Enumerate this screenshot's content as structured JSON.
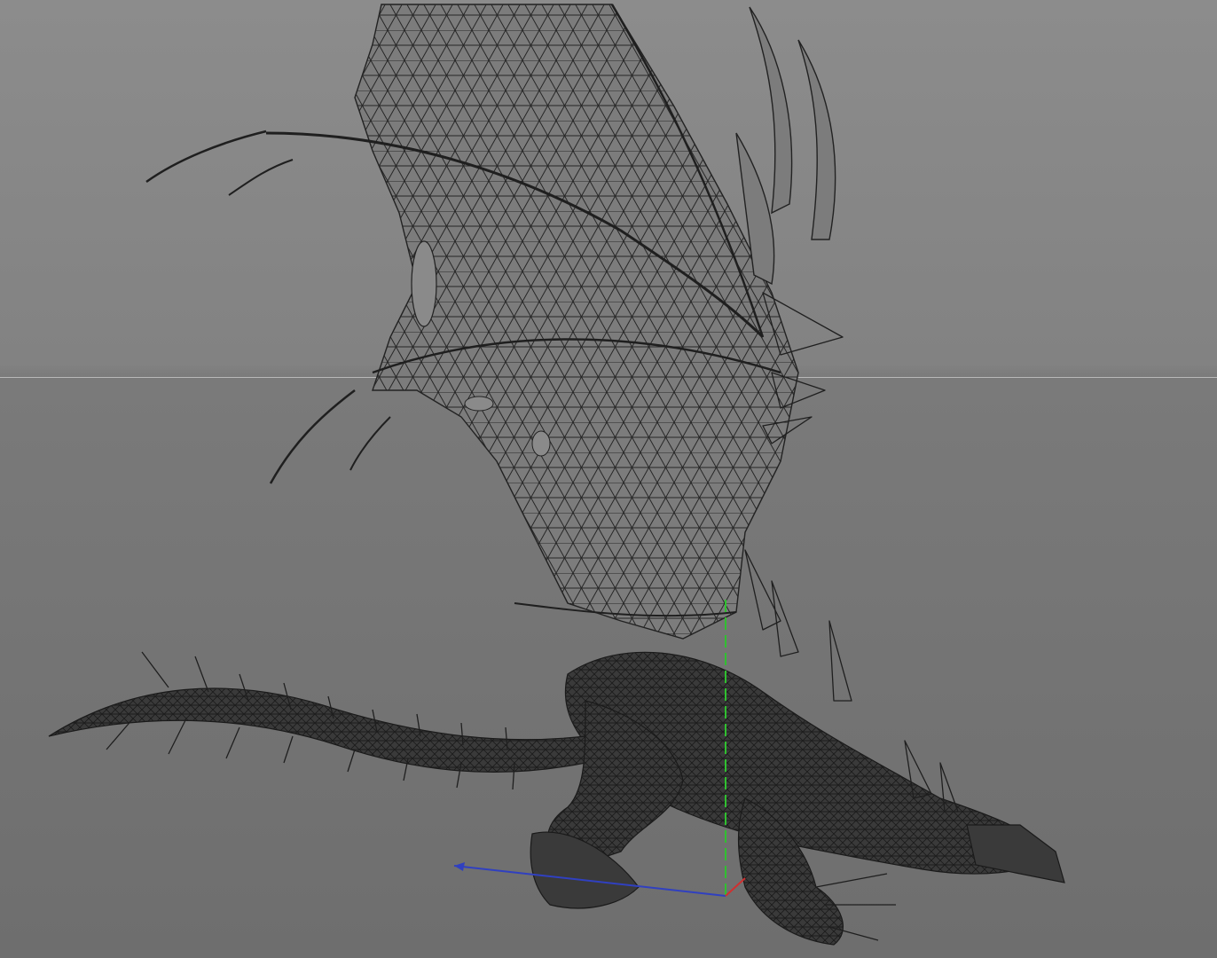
{
  "viewport": {
    "background_top": "#8c8c8c",
    "background_bottom": "#6e6e6e",
    "horizon_color": "#b8b8b8",
    "wire_color": "#1f1f1f"
  },
  "model": {
    "render_mode": "wireframe",
    "subject_icon": "dragon-wireframe-icon"
  },
  "gizmo": {
    "axis_x_color": "#d03030",
    "axis_y_color": "#30c030",
    "axis_z_color": "#3040c0"
  }
}
